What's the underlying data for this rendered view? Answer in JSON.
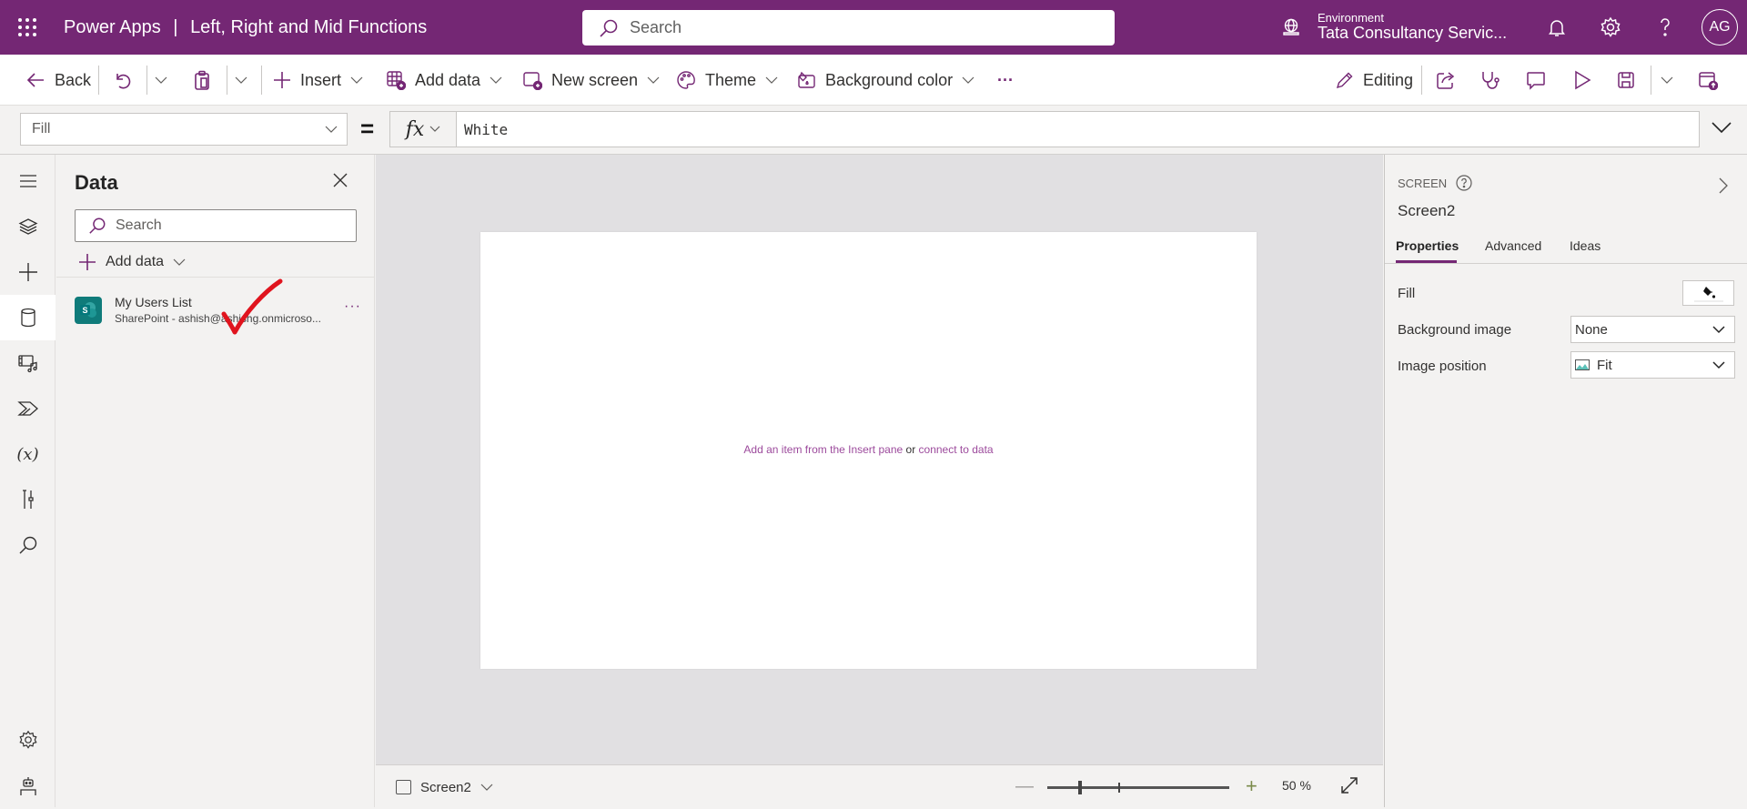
{
  "topbar": {
    "app_name": "Power Apps",
    "separator": "|",
    "app_title": "Left, Right and Mid Functions",
    "search_placeholder": "Search",
    "environment_label": "Environment",
    "environment_name": "Tata Consultancy Servic...",
    "avatar_initials": "AG",
    "brand_color": "#742774"
  },
  "commandbar": {
    "back": "Back",
    "insert": "Insert",
    "add_data": "Add data",
    "new_screen": "New screen",
    "theme": "Theme",
    "background_color": "Background color",
    "more": "···",
    "editing": "Editing"
  },
  "formulabar": {
    "property": "Fill",
    "equals": "=",
    "fx": "fx",
    "formula": "White"
  },
  "datapane": {
    "title": "Data",
    "search_placeholder": "Search",
    "add_data": "Add data",
    "sources": [
      {
        "name": "My Users List",
        "subtitle": "SharePoint - ashish@ashishg.onmicroso...",
        "logo_letter": "S",
        "more": "···"
      }
    ]
  },
  "canvas": {
    "hint_part1": "Add an item from the Insert pane",
    "hint_or": "or",
    "hint_part2": "connect to data"
  },
  "bottombar": {
    "screen_name": "Screen2",
    "zoom_minus": "—",
    "zoom_plus": "+",
    "zoom_percent": 50,
    "zoom_label": "50  %"
  },
  "rightpane": {
    "kind": "SCREEN",
    "name": "Screen2",
    "tabs": [
      "Properties",
      "Advanced",
      "Ideas"
    ],
    "active_tab": "Properties",
    "properties": {
      "fill_label": "Fill",
      "fill_value": "White",
      "background_image_label": "Background image",
      "background_image_value": "None",
      "image_position_label": "Image position",
      "image_position_value": "Fit"
    }
  }
}
